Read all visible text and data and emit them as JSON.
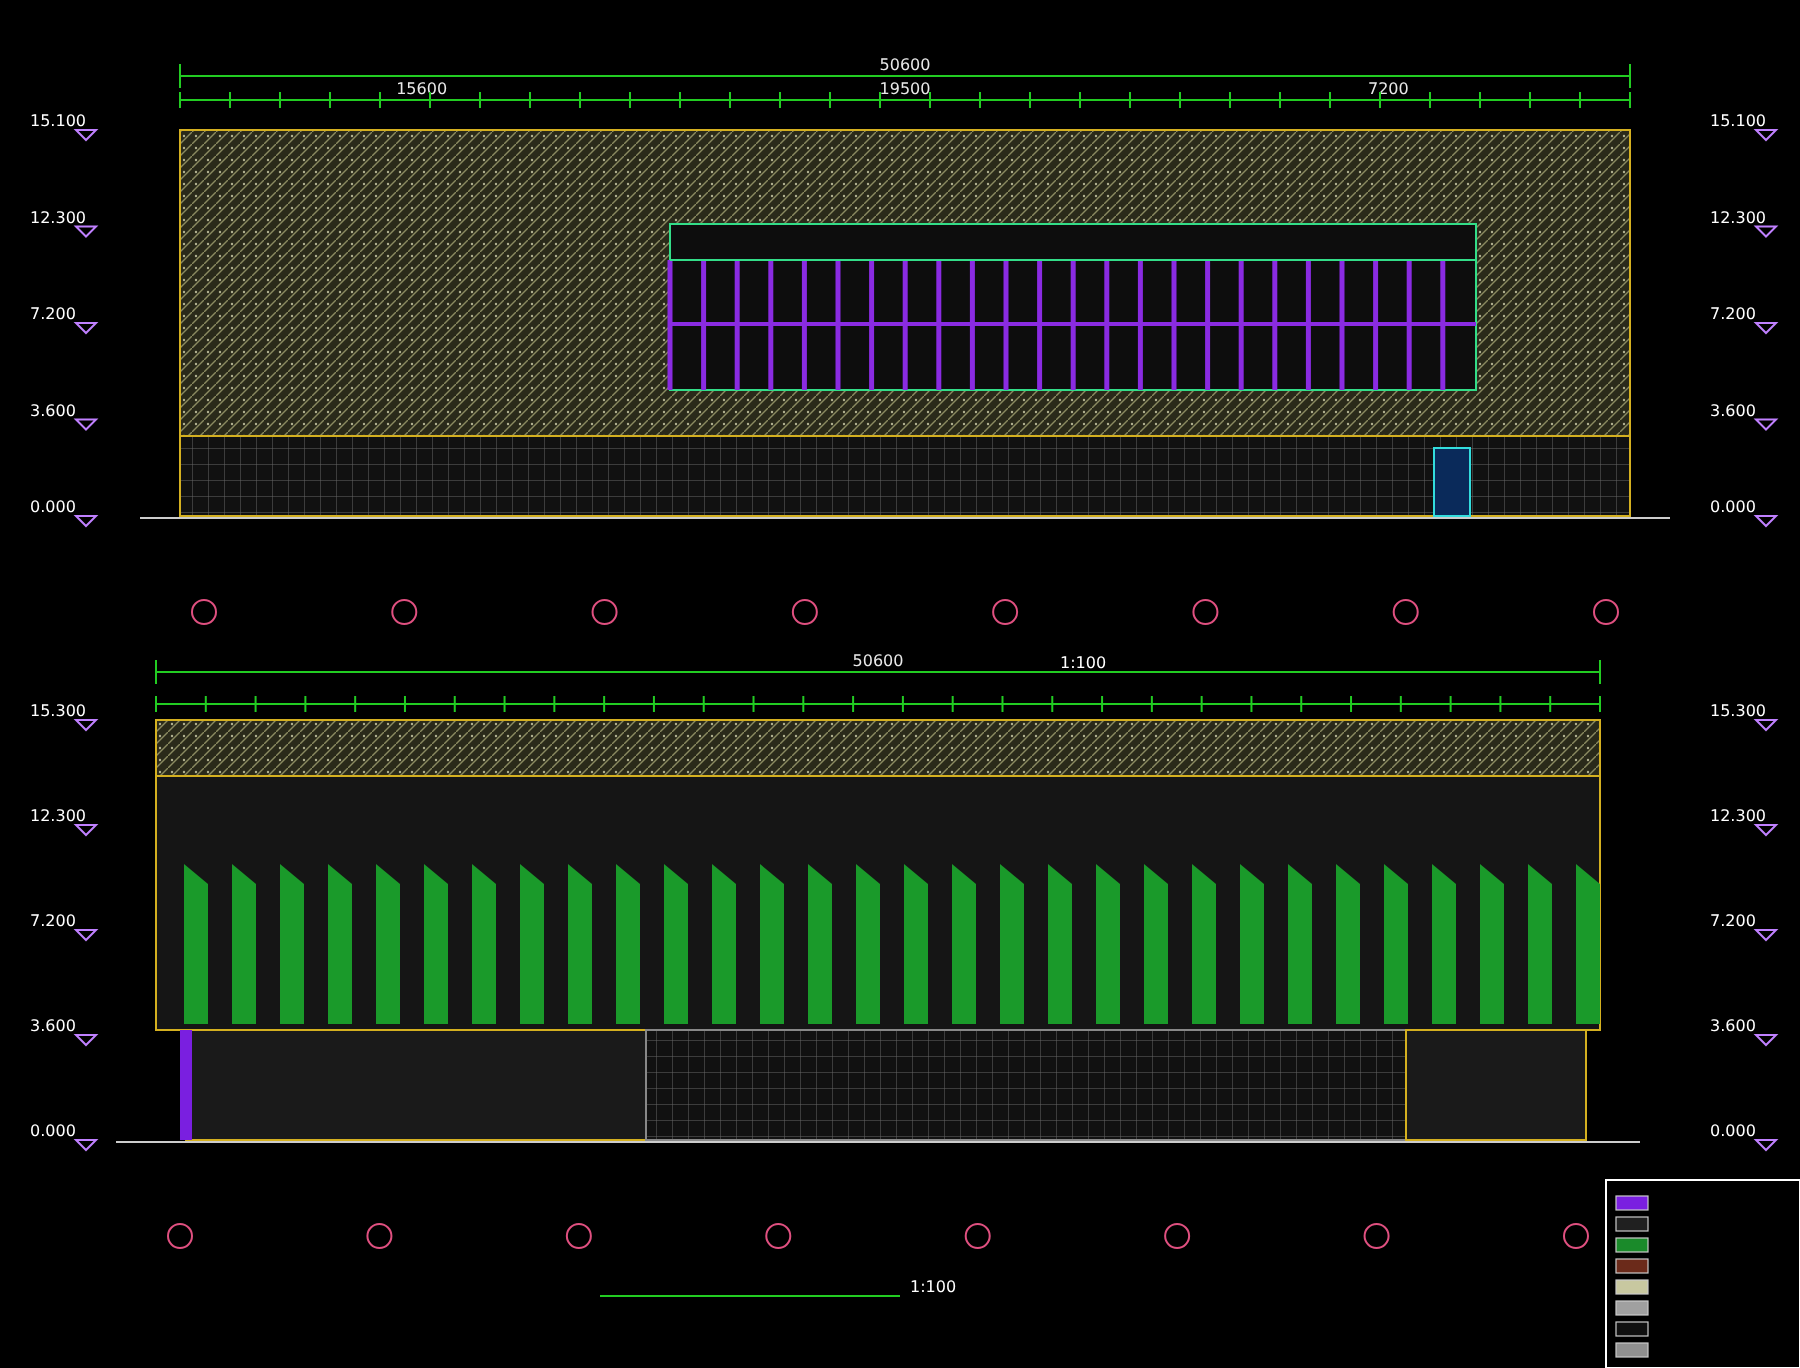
{
  "elevations": [
    {
      "kind": "window-band",
      "overall_dim": "50600",
      "segment_dims": [
        "15600",
        "19500",
        "7200"
      ],
      "left_levels": [
        "15.100",
        "12.300",
        "7.200",
        "3.600",
        "0.000"
      ],
      "right_levels": [
        "15.100",
        "12.300",
        "7.200",
        "3.600",
        "0.000"
      ],
      "scale": "1:100"
    },
    {
      "kind": "fins",
      "overall_dim": "50600",
      "left_levels": [
        "15.300",
        "12.300",
        "7.200",
        "3.600",
        "0.000"
      ],
      "right_levels": [
        "15.300",
        "12.300",
        "7.200",
        "3.600",
        "0.000"
      ],
      "scale": "1:100"
    }
  ],
  "legend": {
    "swatches": [
      {
        "color": "#7a1fe0"
      },
      {
        "color": "#202020"
      },
      {
        "color": "#1a8a2a"
      },
      {
        "color": "#6b2a1a"
      },
      {
        "color": "#c8c8a0"
      },
      {
        "color": "#a0a0a0"
      },
      {
        "color": "#101010"
      },
      {
        "color": "#909090"
      }
    ]
  }
}
